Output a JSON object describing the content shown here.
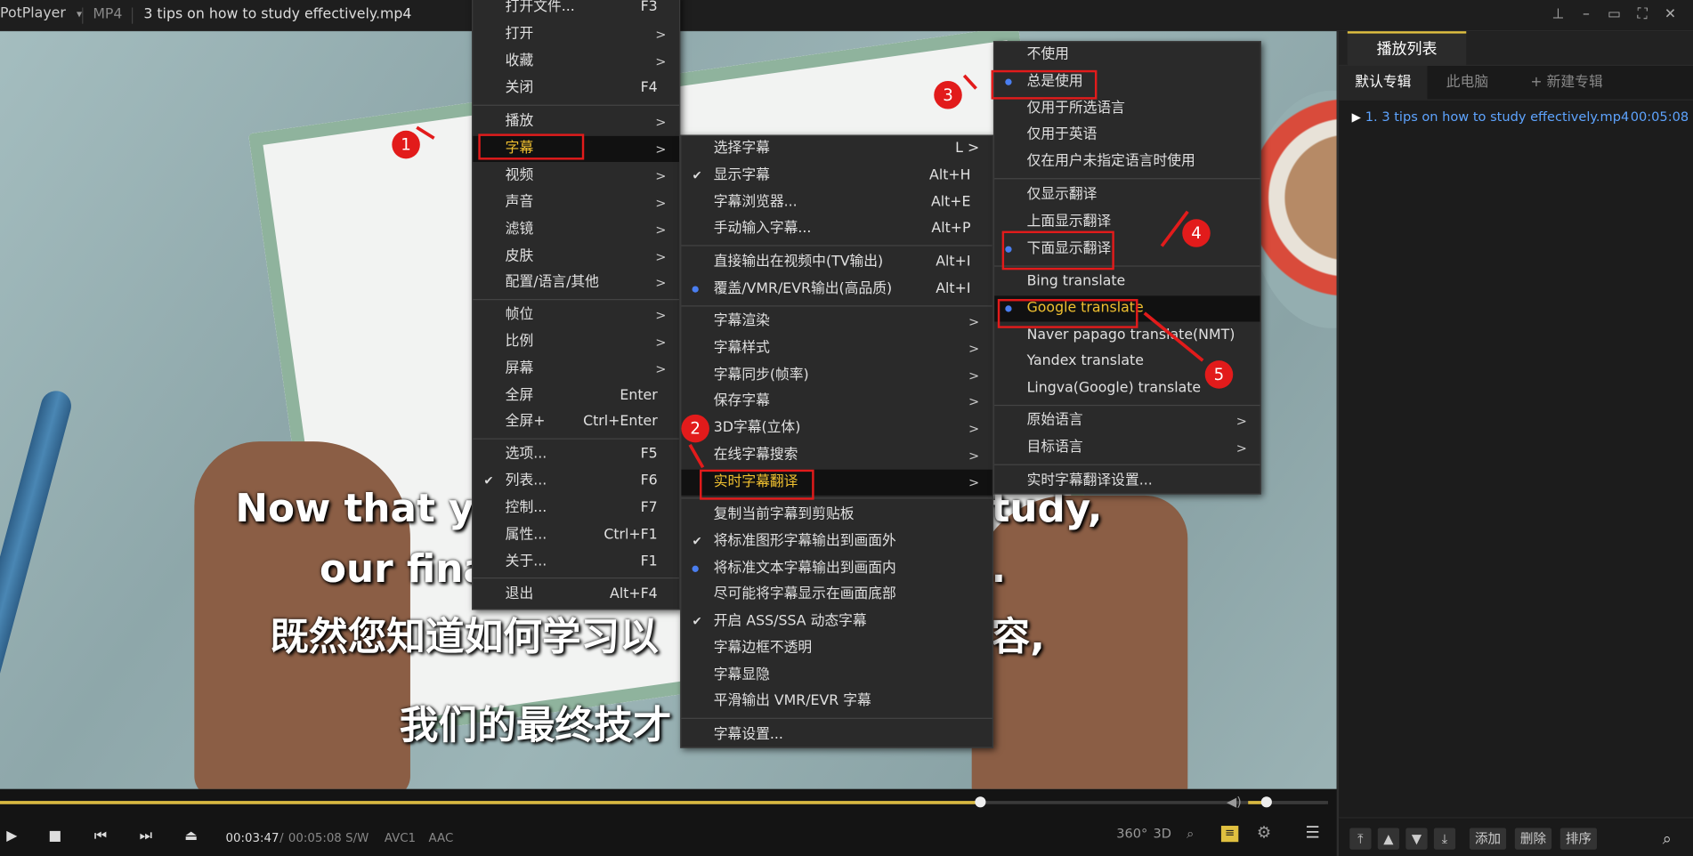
{
  "title_bar": {
    "app_name": "PotPlayer",
    "format": "MP4",
    "file_name": "3 tips on how to study effectively.mp4"
  },
  "subtitles": {
    "en_line1": "Now that yo",
    "en_line1_right": "tudy,",
    "en_line2": "our fina",
    "en_line2_right": ".",
    "zh_line1": "既然您知道如何学习以",
    "zh_line1_right": "容,",
    "zh_line2": "我们的最终技才"
  },
  "controls": {
    "current_time": "00:03:47",
    "separator": "/",
    "duration": "00:05:08",
    "tag_sw": "S/W",
    "tag_codec": "AVC1",
    "tag_audio": "AAC",
    "btn_360": "360°",
    "btn_3d": "3D",
    "seek_progress": 0.738,
    "volume_level": 0.25
  },
  "sidebar": {
    "tab_playlist": "播放列表",
    "subtab_default": "默认专辑",
    "subtab_pc": "此电脑",
    "subtab_new": "+ 新建专辑",
    "item_name": "1. 3 tips on how to study effectively.mp4",
    "item_duration": "00:05:08",
    "btn_add": "添加",
    "btn_delete": "删除",
    "btn_sort": "排序"
  },
  "menu_main": {
    "open_file": "打开文件...",
    "open_file_sc": "F3",
    "open": "打开",
    "favorites": "收藏",
    "close": "关闭",
    "close_sc": "F4",
    "play": "播放",
    "subtitle": "字幕",
    "video": "视频",
    "audio": "声音",
    "filter": "滤镜",
    "skin": "皮肤",
    "config": "配置/语言/其他",
    "frame": "帧位",
    "ratio": "比例",
    "screen": "屏幕",
    "fullscreen": "全屏",
    "fullscreen_sc": "Enter",
    "fullscreen_plus": "全屏+",
    "fullscreen_plus_sc": "Ctrl+Enter",
    "options": "选项...",
    "options_sc": "F5",
    "list": "列表...",
    "list_sc": "F6",
    "control": "控制...",
    "control_sc": "F7",
    "properties": "属性...",
    "properties_sc": "Ctrl+F1",
    "about": "关于...",
    "about_sc": "F1",
    "exit": "退出",
    "exit_sc": "Alt+F4",
    "arrow": ">"
  },
  "menu_subtitle": {
    "select": "选择字幕",
    "select_sc": "L >",
    "show": "显示字幕",
    "show_sc": "Alt+H",
    "browser": "字幕浏览器...",
    "browser_sc": "Alt+E",
    "manual": "手动输入字幕...",
    "manual_sc": "Alt+P",
    "direct": "直接输出在视频中(TV输出)",
    "direct_sc": "Alt+I",
    "overlay": "覆盖/VMR/EVR输出(高品质)",
    "overlay_sc": "Alt+I",
    "render": "字幕渲染",
    "style": "字幕样式",
    "sync": "字幕同步(帧率)",
    "save": "保存字幕",
    "stereo": "3D字幕(立体)",
    "online": "在线字幕搜索",
    "realtime": "实时字幕翻译",
    "copy": "复制当前字幕到剪贴板",
    "std_graphic": "将标准图形字幕输出到画面外",
    "std_text": "将标准文本字幕输出到画面内",
    "bottom": "尽可能将字幕显示在画面底部",
    "ass": "开启 ASS/SSA 动态字幕",
    "border": "字幕边框不透明",
    "toggle": "字幕显隐",
    "smooth": "平滑输出 VMR/EVR 字幕",
    "settings": "字幕设置..."
  },
  "menu_translate": {
    "not_use": "不使用",
    "always": "总是使用",
    "only_selected": "仅用于所选语言",
    "only_english": "仅用于英语",
    "only_unspecified": "仅在用户未指定语言时使用",
    "only_translation": "仅显示翻译",
    "above": "上面显示翻译",
    "below": "下面显示翻译",
    "bing": "Bing translate",
    "google": "Google translate",
    "naver": "Naver papago translate(NMT)",
    "yandex": "Yandex translate",
    "lingva": "Lingva(Google) translate",
    "source_lang": "原始语言",
    "target_lang": "目标语言",
    "settings": "实时字幕翻译设置..."
  },
  "annotations": {
    "n1": "1",
    "n2": "2",
    "n3": "3",
    "n4": "4",
    "n5": "5",
    "color": "#e21b1b"
  }
}
